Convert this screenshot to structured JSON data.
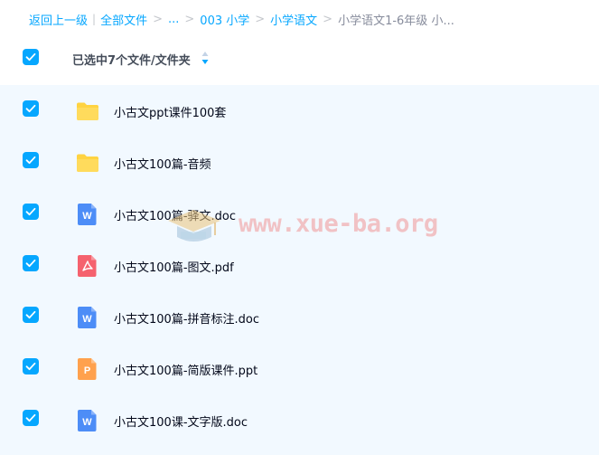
{
  "breadcrumb": {
    "back": "返回上一级",
    "all_files": "全部文件",
    "ellipsis": "...",
    "level1": "003 小学",
    "level2": "小学语文",
    "current": "小学语文1-6年级 小..."
  },
  "header": {
    "selection_label": "已选中7个文件/文件夹",
    "select_all_checked": true
  },
  "files": [
    {
      "name": "小古文ppt课件100套",
      "type": "folder",
      "checked": true
    },
    {
      "name": "小古文100篇-音频",
      "type": "folder",
      "checked": true
    },
    {
      "name": "小古文100篇-驿文.doc",
      "type": "doc",
      "checked": true
    },
    {
      "name": "小古文100篇-图文.pdf",
      "type": "pdf",
      "checked": true
    },
    {
      "name": "小古文100篇-拼音标注.doc",
      "type": "doc",
      "checked": true
    },
    {
      "name": "小古文100篇-简版课件.ppt",
      "type": "ppt",
      "checked": true
    },
    {
      "name": "小古文100课-文字版.doc",
      "type": "doc",
      "checked": true
    }
  ],
  "watermark": {
    "text": "www.xue-ba.org"
  },
  "colors": {
    "accent": "#06a7ff",
    "list_bg": "#f2f9ff",
    "folder": "#ffd341",
    "doc": "#4d8df7",
    "pdf": "#f5626e",
    "ppt": "#ffa14d"
  }
}
